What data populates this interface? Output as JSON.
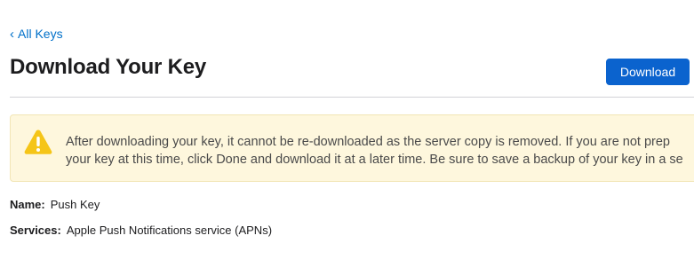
{
  "nav": {
    "back_chevron": "‹",
    "back_label": "All Keys"
  },
  "header": {
    "title": "Download Your Key",
    "download_label": "Download"
  },
  "warning": {
    "icon": "warning-triangle-icon",
    "line1": "After downloading your key, it cannot be re-downloaded as the server copy is removed. If you are not prep",
    "line2": "your key at this time, click Done and download it at a later time. Be sure to save a backup of your key in a se"
  },
  "details": {
    "name_label": "Name:",
    "name_value": "Push Key",
    "services_label": "Services:",
    "services_value": "Apple Push Notifications service (APNs)"
  },
  "colors": {
    "accent": "#0b63ce",
    "link": "#0070c9",
    "warning_bg": "#fef7dd",
    "warning_icon": "#f5c518"
  }
}
